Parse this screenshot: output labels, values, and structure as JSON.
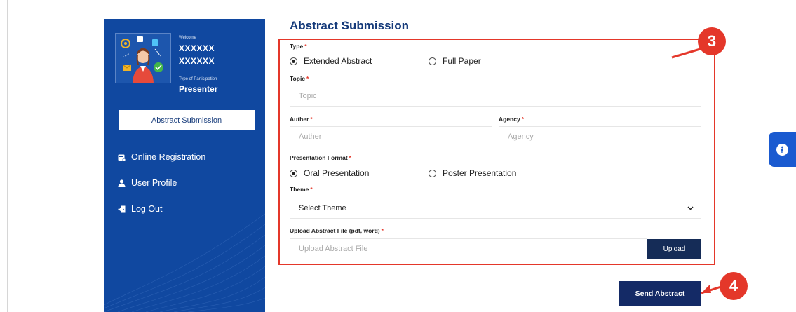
{
  "sidebar": {
    "welcome_label": "Welcome",
    "user_name_line1": "XXXXXX",
    "user_name_line2": "XXXXXX",
    "participation_label": "Type of Participation",
    "participation_value": "Presenter",
    "active_button": "Abstract Submission",
    "items": [
      {
        "label": "Online Registration",
        "icon": "registration-icon"
      },
      {
        "label": "User Profile",
        "icon": "user-icon"
      },
      {
        "label": "Log Out",
        "icon": "logout-icon"
      }
    ]
  },
  "form": {
    "title": "Abstract Submission",
    "type_label": "Type",
    "type_options": [
      {
        "label": "Extended Abstract",
        "checked": true
      },
      {
        "label": "Full Paper",
        "checked": false
      }
    ],
    "topic_label": "Topic",
    "topic_placeholder": "Topic",
    "author_label": "Auther",
    "author_placeholder": "Auther",
    "agency_label": "Agency",
    "agency_placeholder": "Agency",
    "format_label": "Presentation Format",
    "format_options": [
      {
        "label": "Oral Presentation",
        "checked": true
      },
      {
        "label": "Poster Presentation",
        "checked": false
      }
    ],
    "theme_label": "Theme",
    "theme_selected": "Select Theme",
    "upload_label": "Upload Abstract File (pdf, word)",
    "upload_placeholder": "Upload Abstract File",
    "upload_button": "Upload",
    "send_button": "Send Abstract",
    "required_mark": "*"
  },
  "callouts": {
    "form_step": "3",
    "send_step": "4"
  },
  "colors": {
    "sidebar_bg": "#1048a0",
    "title": "#153a7a",
    "highlight": "#e4372a",
    "button_dark": "#142a66",
    "a11y": "#1a5ad0"
  },
  "icons": {
    "accessibility": "accessibility-icon",
    "select_arrow": "chevron-down-icon"
  }
}
